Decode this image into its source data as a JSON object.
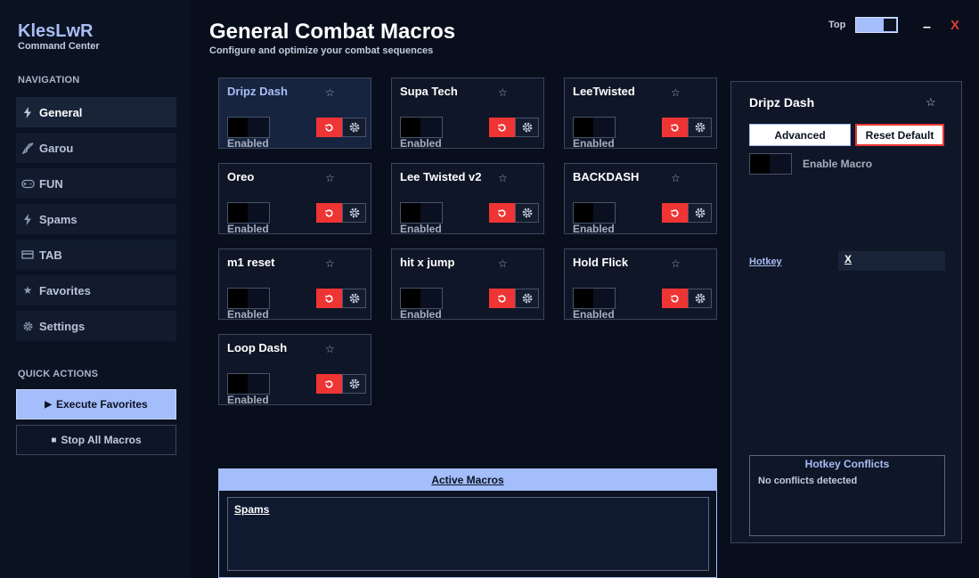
{
  "app": {
    "title": "KlesLwR",
    "subtitle": "Command Center"
  },
  "sidebar": {
    "nav_label": "NAVIGATION",
    "items": [
      {
        "label": "General",
        "icon": "lightning-icon",
        "active": true
      },
      {
        "label": "Garou",
        "icon": "sword-icon",
        "active": false
      },
      {
        "label": "FUN",
        "icon": "gamepad-icon",
        "active": false
      },
      {
        "label": "Spams",
        "icon": "lightning-icon",
        "active": false
      },
      {
        "label": "TAB",
        "icon": "card-icon",
        "active": false
      },
      {
        "label": "Favorites",
        "icon": "star-icon",
        "active": false
      },
      {
        "label": "Settings",
        "icon": "gear-icon",
        "active": false
      }
    ],
    "quick_label": "QUICK ACTIONS",
    "execute_label": "Execute Favorites",
    "stop_label": "Stop All Macros"
  },
  "header": {
    "title": "General Combat Macros",
    "subtitle": "Configure and optimize your combat sequences",
    "top_label": "Top",
    "minimize": "–",
    "close": "X"
  },
  "macros": [
    {
      "name": "Dripz Dash",
      "state": "Enabled",
      "selected": true
    },
    {
      "name": "Supa Tech",
      "state": "Enabled"
    },
    {
      "name": "LeeTwisted",
      "state": "Enabled"
    },
    {
      "name": "Oreo",
      "state": "Enabled"
    },
    {
      "name": "Lee Twisted v2",
      "state": "Enabled"
    },
    {
      "name": "BACKDASH",
      "state": "Enabled"
    },
    {
      "name": "m1 reset",
      "state": "Enabled"
    },
    {
      "name": "hit x jump",
      "state": "Enabled"
    },
    {
      "name": "Hold Flick",
      "state": "Enabled"
    },
    {
      "name": "Loop Dash",
      "state": "Enabled"
    }
  ],
  "active_macros": {
    "title": "Active Macros",
    "group": "Spams"
  },
  "detail": {
    "title": "Dripz Dash",
    "advanced_label": "Advanced",
    "reset_label": "Reset Default",
    "enable_label": "Enable Macro",
    "hotkey_label": "Hotkey",
    "hotkey_value": "X",
    "conflicts_title": "Hotkey Conflicts",
    "conflicts_msg": "No conflicts detected"
  },
  "colors": {
    "accent": "#a4bdfb",
    "danger": "#ef3434",
    "background": "#080e1c"
  }
}
